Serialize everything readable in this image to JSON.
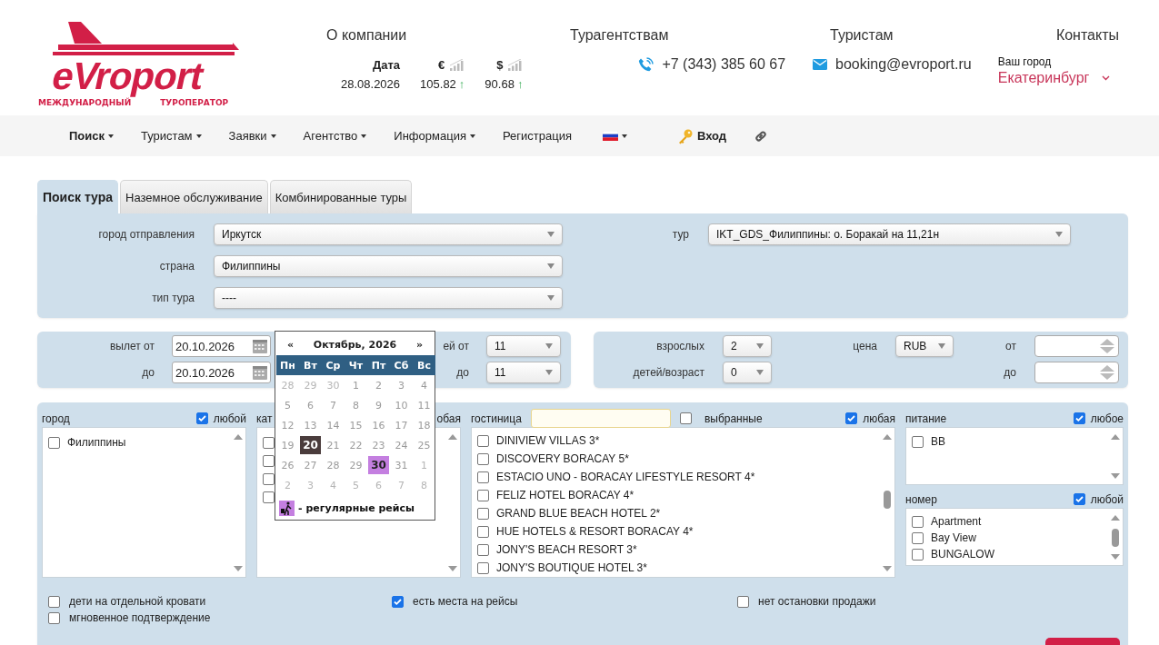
{
  "logo": {
    "name": "eVroport",
    "tagline_1": "МЕЖДУНАРОДНЫЙ",
    "tagline_2": "ТУРОПЕРАТОР"
  },
  "top_menu": [
    "О компании",
    "Турагентствам",
    "Туристам",
    "Контакты"
  ],
  "rates": {
    "date_label": "Дата",
    "date": "28.08.2026",
    "currencies": [
      {
        "symbol": "€",
        "value": "105.82",
        "arrow": "↑"
      },
      {
        "symbol": "$",
        "value": "90.68",
        "arrow": "↑"
      }
    ]
  },
  "phone": "+7 (343) 385 60 67",
  "email": "booking@evroport.ru",
  "city": {
    "label": "Ваш город",
    "value": "Екатеринбург"
  },
  "nav": [
    {
      "kind": "menu",
      "label": "Поиск",
      "selected": true,
      "dropdown": true
    },
    {
      "kind": "menu",
      "label": "Туристам",
      "selected": false,
      "dropdown": true
    },
    {
      "kind": "menu",
      "label": "Заявки",
      "selected": false,
      "dropdown": true
    },
    {
      "kind": "menu",
      "label": "Агентство",
      "selected": false,
      "dropdown": true
    },
    {
      "kind": "menu",
      "label": "Информация",
      "selected": false,
      "dropdown": true
    },
    {
      "kind": "menu",
      "label": "Регистрация",
      "selected": false,
      "dropdown": false
    },
    {
      "kind": "flag",
      "dropdown": true
    },
    {
      "kind": "login",
      "label": "Вход"
    },
    {
      "kind": "link"
    }
  ],
  "tabs": [
    {
      "label": "Поиск тура",
      "selected": true
    },
    {
      "label": "Наземное обслуживание",
      "selected": false
    },
    {
      "label": "Комбинированные туры",
      "selected": false
    }
  ],
  "tour_form": {
    "fields": [
      {
        "label": "город отправления",
        "value": "Иркутск"
      },
      {
        "label": "страна",
        "value": "Филиппины"
      },
      {
        "label": "тип тура",
        "value": "----"
      }
    ],
    "tour": {
      "label": "тур",
      "value": "IKT_GDS_Филиппины: о. Боракай на 11,21н"
    }
  },
  "dates": [
    {
      "label": "вылет от",
      "date": "20.10.2026",
      "nights_label": "ей от",
      "nights": "11"
    },
    {
      "label": "до",
      "date": "20.10.2026",
      "nights_label": "до",
      "nights": "11"
    }
  ],
  "people": {
    "adults": {
      "label": "взрослых",
      "value": "2"
    },
    "children": {
      "label": "детей/возраст",
      "value": "0"
    },
    "price": {
      "label": "цена",
      "value": "RUB"
    },
    "price_from": {
      "label": "от"
    },
    "price_to": {
      "label": "до"
    }
  },
  "filters": {
    "city": {
      "label": "город",
      "any_label": "любой",
      "any_checked": true,
      "items": [
        {
          "label": "Филиппины",
          "checked": false
        }
      ]
    },
    "category": {
      "label": "кат",
      "any_label": "обая",
      "items": [
        {
          "checked": false
        },
        {
          "checked": false
        },
        {
          "checked": false
        },
        {
          "checked": false
        }
      ]
    },
    "hotel": {
      "label": "гостиница",
      "selected_label": "выбранные",
      "selected_checked": false,
      "any_label": "любая",
      "any_checked": true,
      "items": [
        {
          "label": "DINIVIEW VILLAS 3*",
          "checked": false
        },
        {
          "label": "DISCOVERY BORACAY 5*",
          "checked": false
        },
        {
          "label": "ESTACIO UNO - BORACAY LIFESTYLE RESORT 4*",
          "checked": false
        },
        {
          "label": "FELIZ HOTEL BORACAY 4*",
          "checked": false
        },
        {
          "label": "GRAND BLUE BEACH HOTEL 2*",
          "checked": false
        },
        {
          "label": "HUE HOTELS & RESORT BORACAY 4*",
          "checked": false
        },
        {
          "label": "JONY'S BEACH RESORT 3*",
          "checked": false
        },
        {
          "label": "JONY'S BOUTIQUE HOTEL 3*",
          "checked": false
        }
      ]
    },
    "meal": {
      "label": "питание",
      "any_label": "любое",
      "any_checked": true,
      "items": [
        {
          "label": "BB",
          "checked": false
        }
      ]
    },
    "room": {
      "label": "номер",
      "any_label": "любой",
      "any_checked": true,
      "items": [
        {
          "label": "Apartment",
          "checked": false
        },
        {
          "label": "Bay View",
          "checked": false
        },
        {
          "label": "BUNGALOW",
          "checked": false
        }
      ]
    }
  },
  "options": [
    {
      "label": "дети на отдельной кровати",
      "checked": false
    },
    {
      "label": "есть места на рейсы",
      "checked": true
    },
    {
      "label": "нет остановки продажи",
      "checked": false
    },
    {
      "label": "мгновенное подтверждение",
      "checked": false
    }
  ],
  "calendar": {
    "prev": "«",
    "title": "Октябрь, 2026",
    "next": "»",
    "weekdays": [
      "Пн",
      "Вт",
      "Ср",
      "Чт",
      "Пт",
      "Сб",
      "Вс"
    ],
    "weeks": [
      [
        {
          "day": "28",
          "kind": "other"
        },
        {
          "day": "29",
          "kind": "other"
        },
        {
          "day": "30",
          "kind": "other"
        },
        {
          "day": "1",
          "kind": "day"
        },
        {
          "day": "2",
          "kind": "day"
        },
        {
          "day": "3",
          "kind": "day"
        },
        {
          "day": "4",
          "kind": "day"
        }
      ],
      [
        {
          "day": "5",
          "kind": "day"
        },
        {
          "day": "6",
          "kind": "day"
        },
        {
          "day": "7",
          "kind": "day"
        },
        {
          "day": "8",
          "kind": "day"
        },
        {
          "day": "9",
          "kind": "day"
        },
        {
          "day": "10",
          "kind": "day"
        },
        {
          "day": "11",
          "kind": "day"
        }
      ],
      [
        {
          "day": "12",
          "kind": "day"
        },
        {
          "day": "13",
          "kind": "day"
        },
        {
          "day": "14",
          "kind": "day"
        },
        {
          "day": "15",
          "kind": "day"
        },
        {
          "day": "16",
          "kind": "day"
        },
        {
          "day": "17",
          "kind": "day"
        },
        {
          "day": "18",
          "kind": "day"
        }
      ],
      [
        {
          "day": "19",
          "kind": "day"
        },
        {
          "day": "20",
          "kind": "selected"
        },
        {
          "day": "21",
          "kind": "day"
        },
        {
          "day": "22",
          "kind": "day"
        },
        {
          "day": "23",
          "kind": "day"
        },
        {
          "day": "24",
          "kind": "day"
        },
        {
          "day": "25",
          "kind": "day"
        }
      ],
      [
        {
          "day": "26",
          "kind": "day"
        },
        {
          "day": "27",
          "kind": "day"
        },
        {
          "day": "28",
          "kind": "day"
        },
        {
          "day": "29",
          "kind": "day"
        },
        {
          "day": "30",
          "kind": "flight"
        },
        {
          "day": "31",
          "kind": "day"
        },
        {
          "day": "1",
          "kind": "other"
        }
      ],
      [
        {
          "day": "2",
          "kind": "other"
        },
        {
          "day": "3",
          "kind": "other"
        },
        {
          "day": "4",
          "kind": "other"
        },
        {
          "day": "5",
          "kind": "other"
        },
        {
          "day": "6",
          "kind": "other"
        },
        {
          "day": "7",
          "kind": "other"
        },
        {
          "day": "8",
          "kind": "other"
        }
      ]
    ],
    "legend": "- регулярные рейсы"
  }
}
